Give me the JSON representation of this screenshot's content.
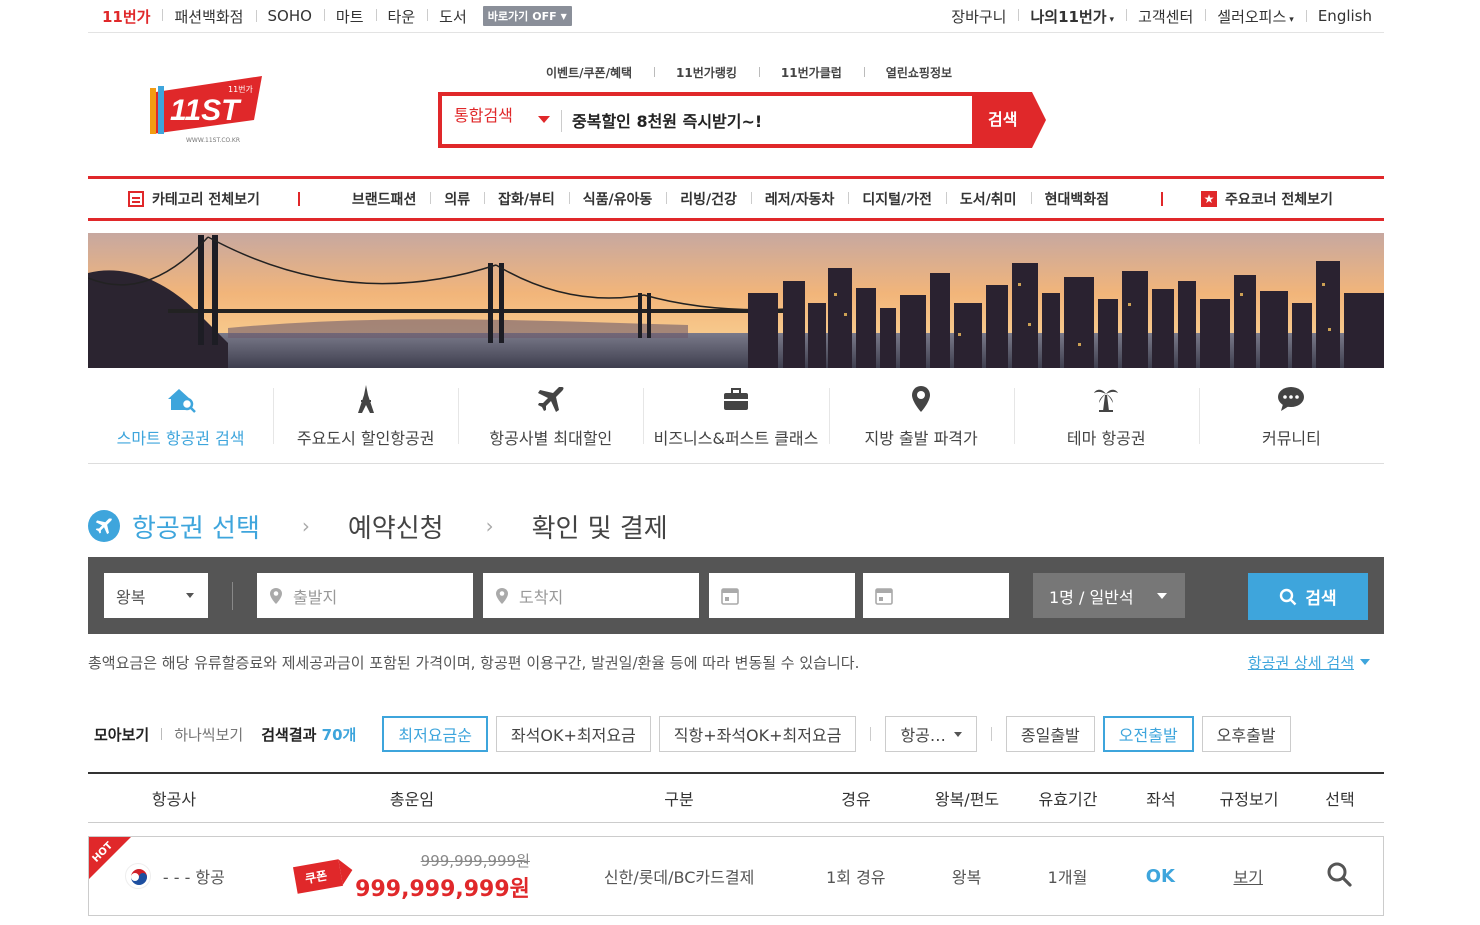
{
  "topbar": {
    "left": [
      "11번가",
      "패션백화점",
      "SOHO",
      "마트",
      "타운",
      "도서"
    ],
    "shortcut_label": "바로가기",
    "shortcut_state": "OFF",
    "right": [
      "장바구니",
      "나의11번가",
      "고객센터",
      "셀러오피스",
      "English"
    ]
  },
  "header": {
    "logo_text": "11ST",
    "logo_sub": "WWW.11ST.CO.KR",
    "logo_badge": "11번가",
    "quick_links": [
      "이벤트/쿠폰/혜택",
      "11번가랭킹",
      "11번가클럽",
      "열린쇼핑정보"
    ],
    "search_scope": "통합검색",
    "search_query": "중복할인 8천원 즉시받기~!",
    "search_button": "검색"
  },
  "catnav": {
    "all_label": "카테고리 전체보기",
    "categories": [
      "브랜드패션",
      "의류",
      "잡화/뷰티",
      "식품/유아동",
      "리빙/건강",
      "레저/자동차",
      "디지털/가전",
      "도서/취미",
      "현대백화점"
    ],
    "major_label": "주요코너 전체보기"
  },
  "services": [
    {
      "label": "스마트 항공권 검색",
      "icon": "house-search-icon",
      "active": true
    },
    {
      "label": "주요도시 할인항공권",
      "icon": "eiffel-tower-icon",
      "active": false
    },
    {
      "label": "항공사별 최대할인",
      "icon": "airplane-icon",
      "active": false
    },
    {
      "label": "비즈니스&퍼스트 클래스",
      "icon": "briefcase-icon",
      "active": false
    },
    {
      "label": "지방 출발 파격가",
      "icon": "map-pin-icon",
      "active": false
    },
    {
      "label": "테마 항공권",
      "icon": "palm-tree-icon",
      "active": false
    },
    {
      "label": "커뮤니티",
      "icon": "chat-bubble-icon",
      "active": false
    }
  ],
  "steps": {
    "s1": "항공권 선택",
    "s2": "예약신청",
    "s3": "확인 및 결제"
  },
  "search_panel": {
    "trip_type": "왕복",
    "origin_placeholder": "출발지",
    "dest_placeholder": "도착지",
    "pax": "1명 / 일반석",
    "button": "검색"
  },
  "notice": {
    "text": "총액요금은 해당 유류할증료와 제세공과금이 포함된 가격이며, 항공편 이용구간, 발권일/환율 등에 따라 변동될 수 있습니다.",
    "advanced": "항공권 상세 검색"
  },
  "filters": {
    "view_all": "모아보기",
    "view_one": "하나씩보기",
    "result_label": "검색결과",
    "result_count": "70개",
    "buttons": [
      "최저요금순",
      "좌석OK+최저요금",
      "직항+좌석OK+최저요금"
    ],
    "airline_select": "항공…",
    "time_buttons": [
      "종일출발",
      "오전출발",
      "오후출발"
    ]
  },
  "table": {
    "headers": [
      "항공사",
      "총운임",
      "구분",
      "경유",
      "왕복/편도",
      "유효기간",
      "좌석",
      "규정보기",
      "선택"
    ]
  },
  "rows": [
    {
      "hot": "HOT",
      "airline": "- - - 항공",
      "coupon": "쿠폰",
      "orig_price": "999,999,999원",
      "final_price": "999,999,999원",
      "type": "신한/롯데/BC카드결제",
      "stops": "1회 경유",
      "trip": "왕복",
      "validity": "1개월",
      "seat": "OK",
      "rule": "보기"
    }
  ],
  "colors": {
    "brand_red": "#e0282a",
    "accent_blue": "#3ea5dc",
    "panel_gray": "#555555"
  }
}
